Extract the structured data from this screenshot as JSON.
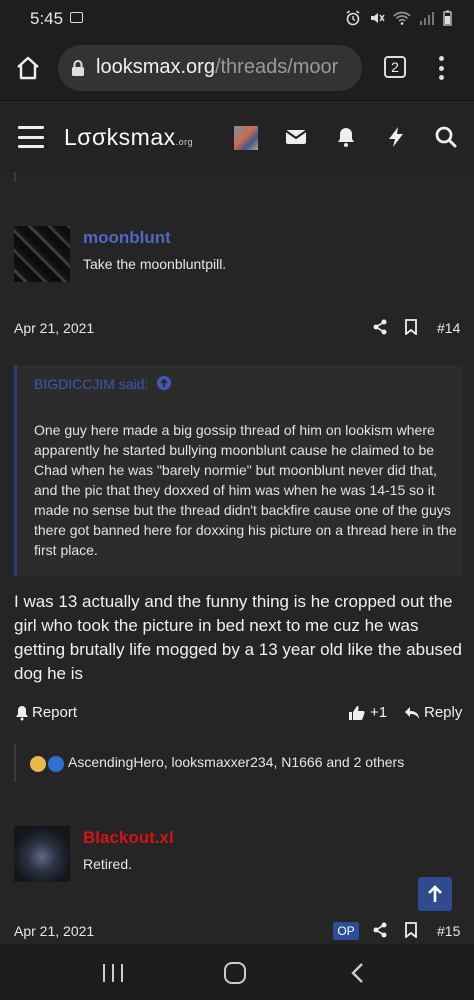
{
  "status_bar": {
    "time": "5:45"
  },
  "browser": {
    "url_host": "looksmax.org",
    "url_path": "/threads/moor",
    "tab_count": "2"
  },
  "site": {
    "logo_main": "Lσσksmax",
    "logo_suffix": ".org"
  },
  "posts": [
    {
      "username": "moonblunt",
      "title": "Take the moonbluntpill.",
      "date": "Apr 21, 2021",
      "number": "#14",
      "quote": {
        "author": "BIGDICCJIM said:",
        "text": "One guy here made a big gossip thread of him on lookism where apparently he started bullying moonblunt cause he claimed to be Chad when he was \"barely normie\" but moonblunt never did that, and the pic that they doxxed of him was when he was 14-15 so it made no sense but the thread didn't backfire cause one of the guys there got banned here for doxxing his picture on a thread here in the first place."
      },
      "body": "I was 13 actually and the funny thing is he cropped out the girl who took the picture in bed next to me cuz he was getting brutally life mogged by a 13 year old like the abused dog he is",
      "actions": {
        "report": "Report",
        "like_count": "+1",
        "reply": "Reply"
      },
      "reactions": "AscendingHero, looksmaxxer234, N1666 and 2 others"
    },
    {
      "username": "Blackout.xl",
      "title": "Retired.",
      "date": "Apr 21, 2021",
      "badge": "OP",
      "number": "#15"
    }
  ],
  "colors": {
    "accent_blue": "#4f68c4",
    "username_red": "#d11414",
    "badge_blue": "#2d4d97"
  }
}
